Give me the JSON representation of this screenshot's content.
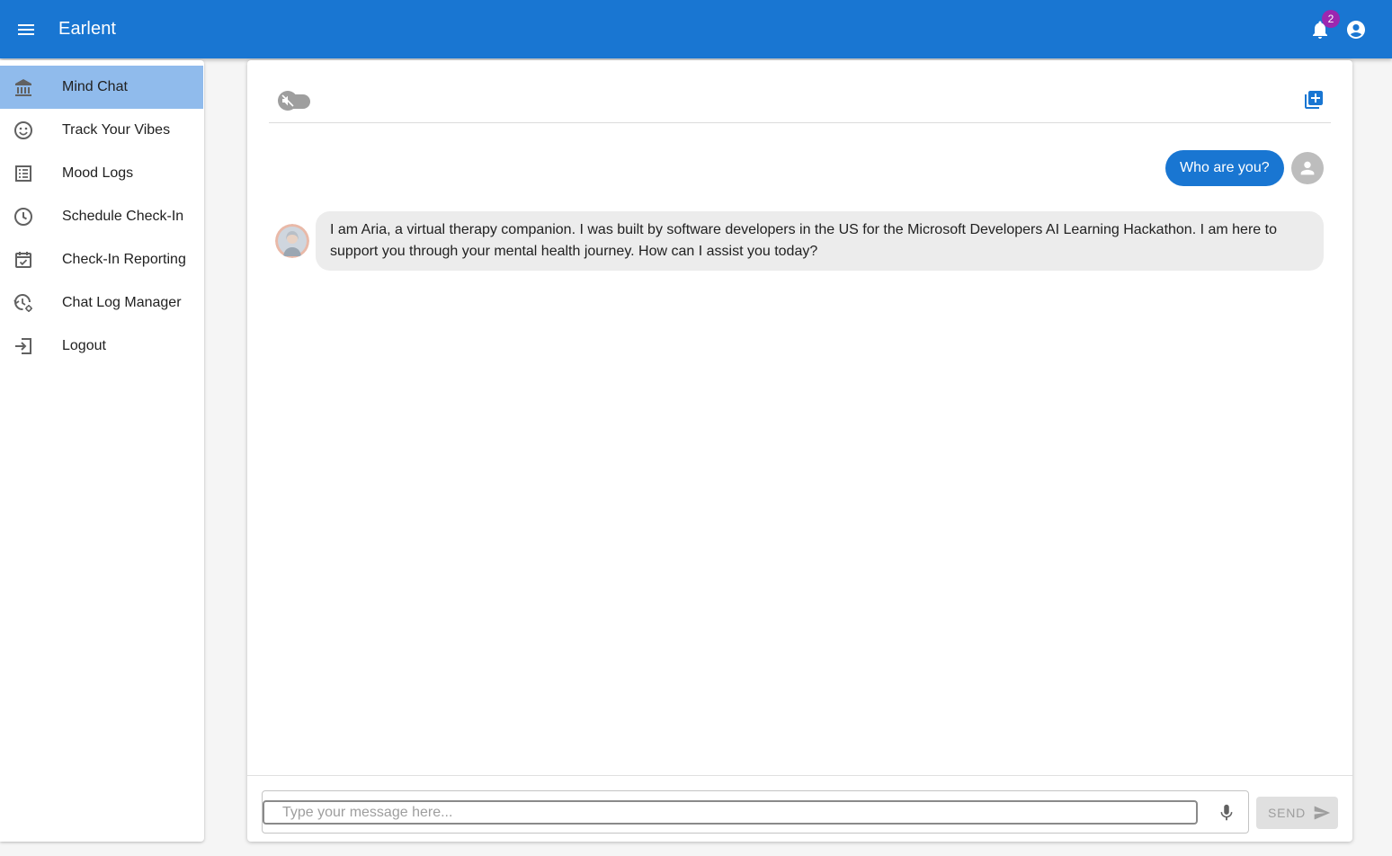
{
  "app": {
    "title": "Earlent",
    "notification_count": "2",
    "accent_color": "#1976d2",
    "badge_color": "#9c27b0"
  },
  "sidebar": {
    "items": [
      {
        "label": "Mind Chat",
        "icon": "brain-chat-icon",
        "active": true
      },
      {
        "label": "Track Your Vibes",
        "icon": "smiley-face-icon"
      },
      {
        "label": "Mood Logs",
        "icon": "list-icon"
      },
      {
        "label": "Schedule Check-In",
        "icon": "clock-icon"
      },
      {
        "label": "Check-In Reporting",
        "icon": "calendar-check-icon"
      },
      {
        "label": "Chat Log Manager",
        "icon": "history-settings-icon"
      },
      {
        "label": "Logout",
        "icon": "logout-icon"
      }
    ]
  },
  "chat": {
    "messages": [
      {
        "role": "user",
        "text": "Who are you?"
      },
      {
        "role": "assistant",
        "text": "I am Aria, a virtual therapy companion. I was built by software developers in the US for the Microsoft Developers AI Learning Hackathon. I am here to support you through your mental health journey. How can I assist you today?"
      }
    ],
    "input": {
      "placeholder": "Type your message here...",
      "value": ""
    },
    "send_label": "SEND"
  }
}
